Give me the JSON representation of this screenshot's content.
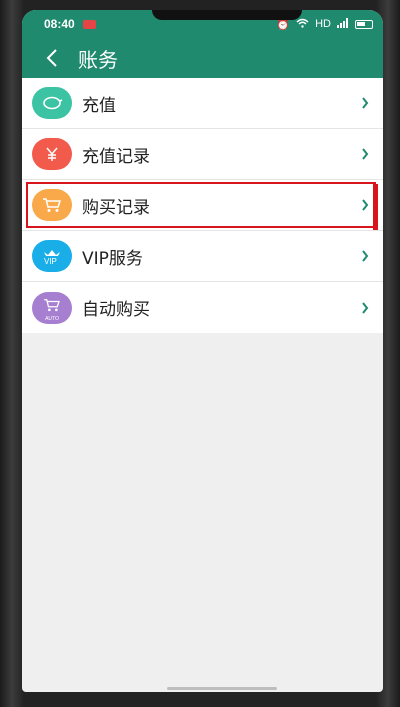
{
  "status": {
    "time": "08:40",
    "network": "HD",
    "badge_color": "#e64545"
  },
  "header": {
    "title": "账务",
    "back_icon": "back-arrow-icon",
    "color": "#1f8a6e"
  },
  "menu": {
    "items": [
      {
        "label": "充值",
        "icon": "piggy-bank-icon",
        "icon_color": "#3cc3a3"
      },
      {
        "label": "充值记录",
        "icon": "yen-icon",
        "icon_color": "#f25a4b"
      },
      {
        "label": "购买记录",
        "icon": "cart-icon",
        "icon_color": "#f9a94a",
        "highlighted": true
      },
      {
        "label": "VIP服务",
        "icon": "vip-crown-icon",
        "icon_color": "#1aaee8"
      },
      {
        "label": "自动购买",
        "icon": "auto-cart-icon",
        "icon_color": "#a77fd1",
        "icon_text": "AUTO"
      }
    ]
  },
  "colors": {
    "highlight": "#d8141c",
    "chevron": "#1f8a6e"
  }
}
